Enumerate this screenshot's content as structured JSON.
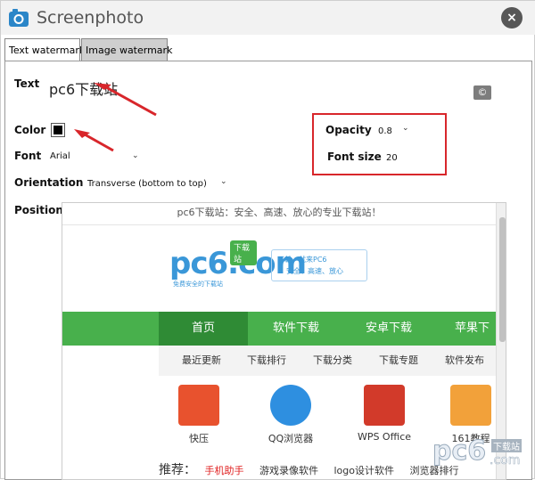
{
  "window": {
    "title": "Screenphoto",
    "close_label": "×"
  },
  "tabs": [
    {
      "label": "Text watermark",
      "active": true
    },
    {
      "label": "Image watermark",
      "active": false
    }
  ],
  "form": {
    "text_label": "Text",
    "text_value": "pc6下载站",
    "copyright_label": "©",
    "color_label": "Color",
    "color_value": "#000000",
    "font_label": "Font",
    "font_value": "Arial",
    "orientation_label": "Orientation",
    "orientation_value": "Transverse (bottom to top)",
    "position_label": "Position",
    "opacity_label": "Opacity",
    "opacity_value": "0.8",
    "font_size_label": "Font size",
    "font_size_value": "20"
  },
  "preview": {
    "top_text": "pc6下载站：安全、高速、放心的专业下载站！",
    "logo_text": "pc6.com",
    "logo_badge": "下载站",
    "logo_sub": "免费安全的下载站",
    "slogan_line1": "下载，就来PC6",
    "slogan_line2": "安全、高速、放心",
    "nav": [
      "首页",
      "软件下载",
      "安卓下载",
      "苹果下"
    ],
    "subnav": [
      "最近更新",
      "下载排行",
      "下载分类",
      "下载专题",
      "软件发布"
    ],
    "apps": [
      {
        "name": "快压",
        "color": "#e8522e",
        "icon": "archive-icon"
      },
      {
        "name": "QQ浏览器",
        "color": "#2e8fe0",
        "icon": "browser-icon"
      },
      {
        "name": "WPS Office",
        "color": "#d23a2a",
        "icon": "wps-icon"
      },
      {
        "name": "161教程",
        "color": "#f2a13a",
        "icon": "p-app-icon"
      }
    ],
    "rec_label": "推荐：",
    "rec_items": [
      "手机助手",
      "游戏录像软件",
      "logo设计软件",
      "浏览器排行"
    ]
  },
  "watermark": {
    "logo_text": "pc6",
    "badge": "下载站",
    "domain": ".com"
  },
  "colors": {
    "accent_red": "#d8262b",
    "nav_green": "#48b04c",
    "logo_blue": "#3a97d8"
  }
}
